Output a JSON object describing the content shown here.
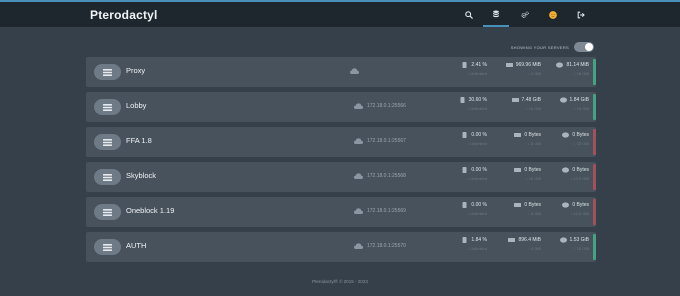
{
  "app": {
    "title": "Pterodactyl"
  },
  "nav": [
    {
      "name": "search-icon",
      "active": false
    },
    {
      "name": "servers-icon",
      "active": true
    },
    {
      "name": "settings-icon",
      "active": false
    },
    {
      "name": "avatar",
      "active": false
    },
    {
      "name": "logout-icon",
      "active": false
    }
  ],
  "toggle": {
    "label": "SHOWING YOUR SERVERS",
    "on": true
  },
  "servers": [
    {
      "name": "Proxy",
      "address": "",
      "status": "online",
      "cpu": "2.41 %",
      "cpu_sub": "↓ Unlimited",
      "memory": "969.96 MiB",
      "memory_sub": "↓ 4 GiB",
      "disk": "81.14 MiB",
      "disk_sub": "↓ 16 GiB"
    },
    {
      "name": "Lobby",
      "address": "172.18.0.1:25566",
      "status": "online",
      "cpu": "30.60 %",
      "cpu_sub": "↓ Unlimited",
      "memory": "7.48 GiB",
      "memory_sub": "↓ 16 GiB",
      "disk": "1.84 GiB",
      "disk_sub": "↓ 15 GiB"
    },
    {
      "name": "FFA 1.8",
      "address": "172.18.0.1:25567",
      "status": "offline",
      "cpu": "0.00 %",
      "cpu_sub": "↓ Unlimited",
      "memory": "0 Bytes",
      "memory_sub": "↓ 8 GiB",
      "disk": "0 Bytes",
      "disk_sub": "↓ 15 GiB"
    },
    {
      "name": "Skyblock",
      "address": "172.18.0.1:25568",
      "status": "offline",
      "cpu": "0.00 %",
      "cpu_sub": "↓ Unlimited",
      "memory": "0 Bytes",
      "memory_sub": "↓ 16 GiB",
      "disk": "0 Bytes",
      "disk_sub": "↓ 10.5 GiB"
    },
    {
      "name": "Oneblock 1.19",
      "address": "172.18.0.1:25569",
      "status": "offline",
      "cpu": "0.00 %",
      "cpu_sub": "↓ Unlimited",
      "memory": "0 Bytes",
      "memory_sub": "↓ 8 GiB",
      "disk": "0 Bytes",
      "disk_sub": "↓ 12.5 GiB"
    },
    {
      "name": "AUTH",
      "address": "172.18.0.1:25570",
      "status": "online",
      "cpu": "1.84 %",
      "cpu_sub": "↓ Unlimited",
      "memory": "896.4 MiB",
      "memory_sub": "↓ 4 GiB",
      "disk": "1.53 GiB",
      "disk_sub": "↓ 15 GiB"
    }
  ],
  "footer": {
    "text": "Pterodactyl® © 2015 - 2023"
  },
  "colors": {
    "accent": "#4a8fb8",
    "online": "#43a383",
    "offline": "#a4505b",
    "avatar": "#f2b233"
  }
}
